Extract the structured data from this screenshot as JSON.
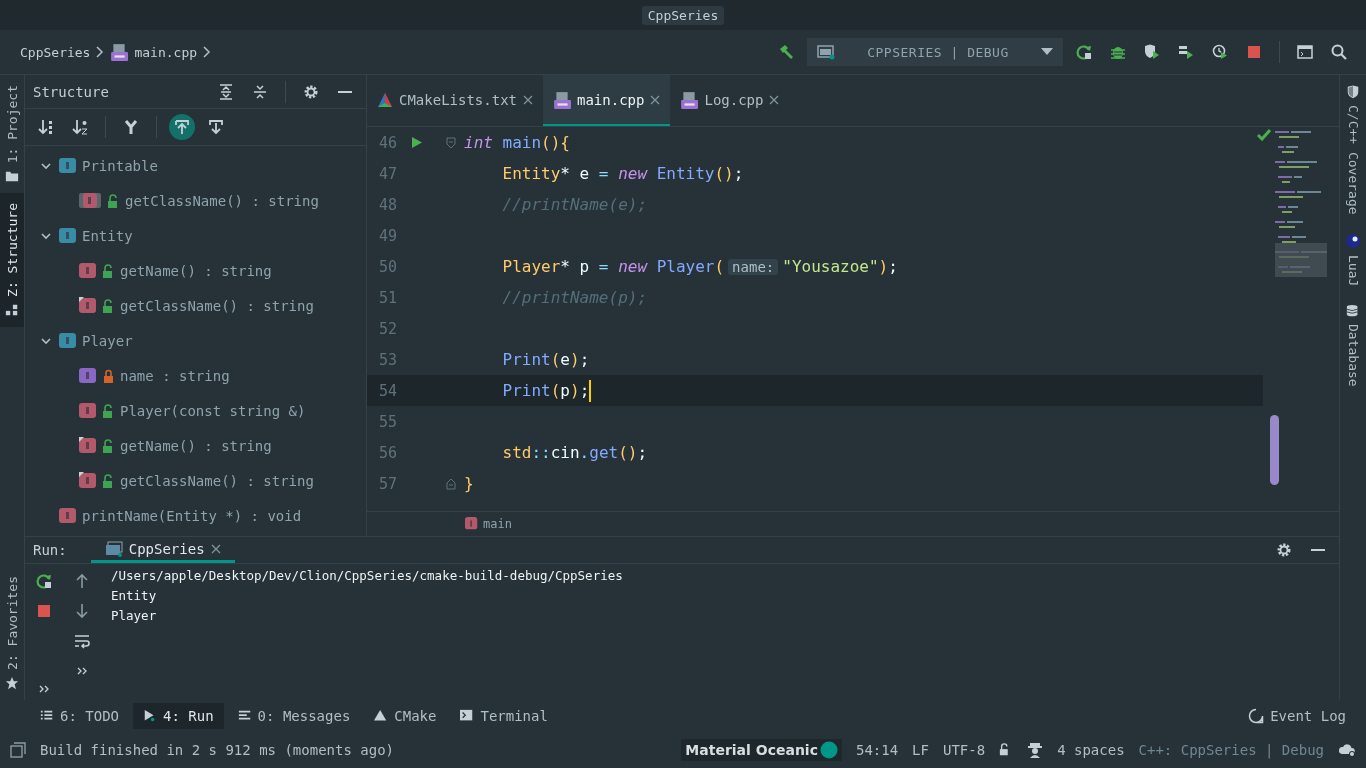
{
  "window": {
    "title": "CppSeries"
  },
  "breadcrumb": [
    {
      "label": "CppSeries",
      "kind": "folder"
    },
    {
      "label": "main.cpp",
      "kind": "cpp"
    }
  ],
  "run_config": {
    "label": "CPPSERIES | DEBUG"
  },
  "left_tool_windows": [
    {
      "label": "1: Project",
      "selected": false,
      "kind": "folder"
    },
    {
      "label": "Z: Structure",
      "selected": true,
      "kind": "structure"
    }
  ],
  "left_bottom_tool_windows": [
    {
      "label": "2: Favorites",
      "selected": false,
      "kind": "star"
    }
  ],
  "structure": {
    "title": "Structure",
    "items": [
      {
        "label": "Printable",
        "kind": "class",
        "expanded": true,
        "children": [
          {
            "label": "getClassName() : string",
            "kind": "method",
            "locked": false,
            "abstract": true,
            "overrides": false
          }
        ]
      },
      {
        "label": "Entity",
        "kind": "class",
        "expanded": true,
        "children": [
          {
            "label": "getName() : string",
            "kind": "method",
            "locked": false,
            "abstract": false,
            "overrides": false
          },
          {
            "label": "getClassName() : string",
            "kind": "method",
            "locked": false,
            "abstract": false,
            "overrides": true
          }
        ]
      },
      {
        "label": "Player",
        "kind": "class",
        "expanded": true,
        "children": [
          {
            "label": "name : string",
            "kind": "field",
            "locked": true,
            "abstract": false,
            "overrides": false
          },
          {
            "label": "Player(const string &)",
            "kind": "method",
            "locked": false,
            "abstract": false,
            "overrides": false
          },
          {
            "label": "getName() : string",
            "kind": "method",
            "locked": false,
            "abstract": false,
            "overrides": true
          },
          {
            "label": "getClassName() : string",
            "kind": "method",
            "locked": false,
            "abstract": false,
            "overrides": true
          }
        ]
      },
      {
        "label": "printName(Entity *) : void",
        "kind": "function"
      }
    ]
  },
  "editor": {
    "tabs": [
      {
        "label": "CMakeLists.txt",
        "kind": "cmake",
        "selected": false
      },
      {
        "label": "main.cpp",
        "kind": "cpp",
        "selected": true
      },
      {
        "label": "Log.cpp",
        "kind": "cpp",
        "selected": false
      }
    ],
    "lines": [
      {
        "number": "46",
        "run": true,
        "fold_start": true,
        "fold_end": false,
        "current": false,
        "indented": false,
        "tokens": [
          {
            "text": "int",
            "kind": "keyword",
            "gap": false
          },
          {
            "text": "main",
            "kind": "function",
            "gap": true
          },
          {
            "text": "(){",
            "kind": "brace",
            "gap": false
          }
        ]
      },
      {
        "number": "47",
        "run": false,
        "fold_start": false,
        "fold_end": false,
        "current": false,
        "indented": true,
        "tokens": [
          {
            "text": "Entity",
            "kind": "type",
            "gap": false
          },
          {
            "text": "*",
            "kind": "plain",
            "gap": false
          },
          {
            "text": "e",
            "kind": "plain",
            "gap": true
          },
          {
            "text": "=",
            "kind": "operator",
            "gap": true
          },
          {
            "text": "new",
            "kind": "keyword",
            "gap": true
          },
          {
            "text": "Entity",
            "kind": "function",
            "gap": true
          },
          {
            "text": "()",
            "kind": "brace",
            "gap": false
          },
          {
            "text": ";",
            "kind": "plain",
            "gap": false
          }
        ]
      },
      {
        "number": "48",
        "run": false,
        "fold_start": false,
        "fold_end": false,
        "current": false,
        "indented": true,
        "tokens": [
          {
            "text": "//printName(e);",
            "kind": "comment",
            "gap": false
          }
        ]
      },
      {
        "number": "49",
        "run": false,
        "fold_start": false,
        "fold_end": false,
        "current": false
      },
      {
        "number": "50",
        "run": false,
        "fold_start": false,
        "fold_end": false,
        "current": false,
        "indented": true,
        "tokens": [
          {
            "text": "Player",
            "kind": "type",
            "gap": false
          },
          {
            "text": "*",
            "kind": "plain",
            "gap": false
          },
          {
            "text": "p",
            "kind": "plain",
            "gap": true
          },
          {
            "text": "=",
            "kind": "operator",
            "gap": true
          },
          {
            "text": "new",
            "kind": "keyword",
            "gap": true
          },
          {
            "text": "Player",
            "kind": "function",
            "gap": true
          },
          {
            "text": "(",
            "kind": "brace",
            "gap": false
          },
          {
            "text": "name:",
            "kind": "hint",
            "gap": false
          },
          {
            "text": "\"Yousazoe\"",
            "kind": "string",
            "gap": false
          },
          {
            "text": ")",
            "kind": "brace",
            "gap": false
          },
          {
            "text": ";",
            "kind": "plain",
            "gap": false
          }
        ]
      },
      {
        "number": "51",
        "run": false,
        "fold_start": false,
        "fold_end": false,
        "current": false,
        "indented": true,
        "tokens": [
          {
            "text": "//printName(p);",
            "kind": "comment",
            "gap": false
          }
        ]
      },
      {
        "number": "52",
        "run": false,
        "fold_start": false,
        "fold_end": false,
        "current": false
      },
      {
        "number": "53",
        "run": false,
        "fold_start": false,
        "fold_end": false,
        "current": false,
        "indented": true,
        "tokens": [
          {
            "text": "Print",
            "kind": "function",
            "gap": false
          },
          {
            "text": "(",
            "kind": "brace",
            "gap": false
          },
          {
            "text": "e",
            "kind": "plain",
            "gap": false
          },
          {
            "text": ")",
            "kind": "brace",
            "gap": false
          },
          {
            "text": ";",
            "kind": "plain",
            "gap": false
          }
        ]
      },
      {
        "number": "54",
        "run": false,
        "fold_start": false,
        "fold_end": false,
        "current": true,
        "indented": true,
        "tokens": [
          {
            "text": "Print",
            "kind": "function",
            "gap": false
          },
          {
            "text": "(",
            "kind": "brace",
            "gap": false
          },
          {
            "text": "p",
            "kind": "plain",
            "gap": false
          },
          {
            "text": ")",
            "kind": "brace",
            "gap": false
          },
          {
            "text": ";",
            "kind": "plain",
            "gap": false
          }
        ]
      },
      {
        "number": "55",
        "run": false,
        "fold_start": false,
        "fold_end": false,
        "current": false
      },
      {
        "number": "56",
        "run": false,
        "fold_start": false,
        "fold_end": false,
        "current": false,
        "indented": true,
        "tokens": [
          {
            "text": "std",
            "kind": "type",
            "gap": false
          },
          {
            "text": "::",
            "kind": "operator",
            "gap": false
          },
          {
            "text": "cin",
            "kind": "plain",
            "gap": false
          },
          {
            "text": ".",
            "kind": "operator",
            "gap": false
          },
          {
            "text": "get",
            "kind": "function",
            "gap": false
          },
          {
            "text": "()",
            "kind": "brace",
            "gap": false
          },
          {
            "text": ";",
            "kind": "plain",
            "gap": false
          }
        ]
      },
      {
        "number": "57",
        "run": false,
        "fold_start": false,
        "fold_end": true,
        "current": false,
        "indented": false,
        "tokens": [
          {
            "text": "}",
            "kind": "brace",
            "gap": false
          }
        ]
      }
    ],
    "breadcrumb": "main"
  },
  "right_tool_windows": [
    {
      "label": "C/C++ Coverage",
      "kind": "shield"
    },
    {
      "label": "LuaJ",
      "kind": "lua"
    },
    {
      "label": "Database",
      "kind": "database"
    }
  ],
  "run_panel": {
    "label": "Run:",
    "tabs": [
      {
        "label": "CppSeries",
        "selected": true
      }
    ],
    "output": [
      "/Users/apple/Desktop/Dev/Clion/CppSeries/cmake-build-debug/CppSeries",
      "Entity",
      "Player"
    ]
  },
  "bottom_tabs": [
    {
      "label": "6: TODO",
      "kind": "list",
      "selected": false
    },
    {
      "label": "4: Run",
      "kind": "run",
      "selected": true
    },
    {
      "label": "0: Messages",
      "kind": "messages",
      "selected": false
    },
    {
      "label": "CMake",
      "kind": "cmake",
      "selected": false
    },
    {
      "label": "Terminal",
      "kind": "terminal",
      "selected": false
    }
  ],
  "event_log": "Event Log",
  "status_bar": {
    "message": "Build finished in 2 s 912 ms (moments ago)",
    "theme": "Material Oceanic",
    "position": "54:14",
    "line_separator": "LF",
    "encoding": "UTF-8",
    "indent": "4 spaces",
    "context": "C++: CppSeries | Debug"
  }
}
